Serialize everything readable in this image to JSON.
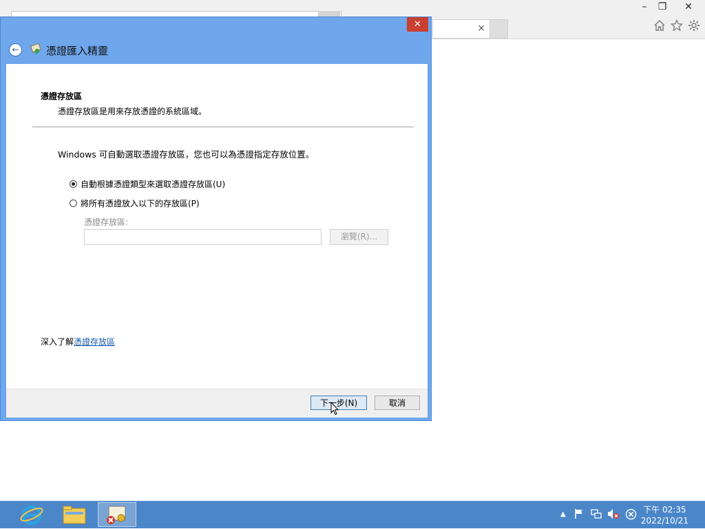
{
  "browser": {
    "tab_close_glyph": "×",
    "window_controls": {
      "minimize": "–",
      "restore": "❐",
      "close": "✕"
    },
    "toolbar_icons": [
      "home-icon",
      "favorites-star-icon",
      "settings-gear-icon"
    ]
  },
  "dialog": {
    "close_glyph": "✕",
    "back_glyph": "←",
    "title": "憑證匯入精靈",
    "section_title": "憑證存放區",
    "section_desc": "憑證存放區是用來存放憑證的系統區域。",
    "intro": "Windows 可自動選取憑證存放區，您也可以為憑證指定存放位置。",
    "options": [
      {
        "label": "自動根據憑證類型來選取憑證存放區(U)",
        "selected": true
      },
      {
        "label": "將所有憑證放入以下的存放區(P)",
        "selected": false
      }
    ],
    "store_label": "憑證存放區:",
    "store_value": "",
    "browse_label": "瀏覽(R)...",
    "learn_prefix": "深入了解",
    "learn_link": "憑證存放區",
    "next_label": "下一步(N)",
    "cancel_label": "取消"
  },
  "taskbar": {
    "apps": [
      "internet-explorer",
      "file-explorer",
      "certificate-wizard"
    ],
    "tray_icons": [
      "show-hidden-icons",
      "action-center-flag-icon",
      "network-icon",
      "volume-muted-icon",
      "close-circle-icon"
    ],
    "time": "下午 02:35",
    "date": "2022/10/21"
  },
  "colors": {
    "dialog_frame": "#6ea7ec",
    "close_button": "#c84031",
    "taskbar": "#4b86c9",
    "link": "#1a5dad"
  }
}
